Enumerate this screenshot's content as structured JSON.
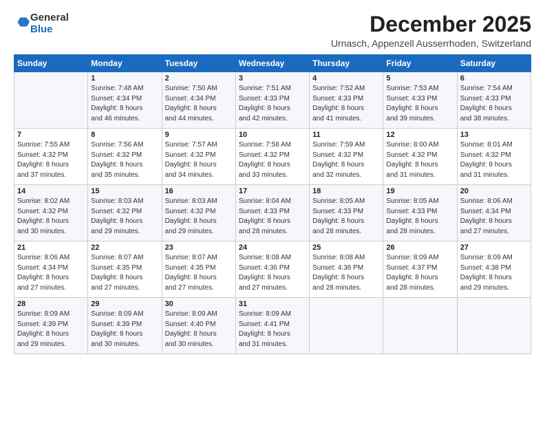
{
  "header": {
    "logo_general": "General",
    "logo_blue": "Blue",
    "month_title": "December 2025",
    "location": "Urnasch, Appenzell Ausserrhoden, Switzerland"
  },
  "columns": [
    "Sunday",
    "Monday",
    "Tuesday",
    "Wednesday",
    "Thursday",
    "Friday",
    "Saturday"
  ],
  "weeks": [
    [
      {
        "day": "",
        "info": ""
      },
      {
        "day": "1",
        "info": "Sunrise: 7:48 AM\nSunset: 4:34 PM\nDaylight: 8 hours\nand 46 minutes."
      },
      {
        "day": "2",
        "info": "Sunrise: 7:50 AM\nSunset: 4:34 PM\nDaylight: 8 hours\nand 44 minutes."
      },
      {
        "day": "3",
        "info": "Sunrise: 7:51 AM\nSunset: 4:33 PM\nDaylight: 8 hours\nand 42 minutes."
      },
      {
        "day": "4",
        "info": "Sunrise: 7:52 AM\nSunset: 4:33 PM\nDaylight: 8 hours\nand 41 minutes."
      },
      {
        "day": "5",
        "info": "Sunrise: 7:53 AM\nSunset: 4:33 PM\nDaylight: 8 hours\nand 39 minutes."
      },
      {
        "day": "6",
        "info": "Sunrise: 7:54 AM\nSunset: 4:33 PM\nDaylight: 8 hours\nand 38 minutes."
      }
    ],
    [
      {
        "day": "7",
        "info": "Sunrise: 7:55 AM\nSunset: 4:32 PM\nDaylight: 8 hours\nand 37 minutes."
      },
      {
        "day": "8",
        "info": "Sunrise: 7:56 AM\nSunset: 4:32 PM\nDaylight: 8 hours\nand 35 minutes."
      },
      {
        "day": "9",
        "info": "Sunrise: 7:57 AM\nSunset: 4:32 PM\nDaylight: 8 hours\nand 34 minutes."
      },
      {
        "day": "10",
        "info": "Sunrise: 7:58 AM\nSunset: 4:32 PM\nDaylight: 8 hours\nand 33 minutes."
      },
      {
        "day": "11",
        "info": "Sunrise: 7:59 AM\nSunset: 4:32 PM\nDaylight: 8 hours\nand 32 minutes."
      },
      {
        "day": "12",
        "info": "Sunrise: 8:00 AM\nSunset: 4:32 PM\nDaylight: 8 hours\nand 31 minutes."
      },
      {
        "day": "13",
        "info": "Sunrise: 8:01 AM\nSunset: 4:32 PM\nDaylight: 8 hours\nand 31 minutes."
      }
    ],
    [
      {
        "day": "14",
        "info": "Sunrise: 8:02 AM\nSunset: 4:32 PM\nDaylight: 8 hours\nand 30 minutes."
      },
      {
        "day": "15",
        "info": "Sunrise: 8:03 AM\nSunset: 4:32 PM\nDaylight: 8 hours\nand 29 minutes."
      },
      {
        "day": "16",
        "info": "Sunrise: 8:03 AM\nSunset: 4:32 PM\nDaylight: 8 hours\nand 29 minutes."
      },
      {
        "day": "17",
        "info": "Sunrise: 8:04 AM\nSunset: 4:33 PM\nDaylight: 8 hours\nand 28 minutes."
      },
      {
        "day": "18",
        "info": "Sunrise: 8:05 AM\nSunset: 4:33 PM\nDaylight: 8 hours\nand 28 minutes."
      },
      {
        "day": "19",
        "info": "Sunrise: 8:05 AM\nSunset: 4:33 PM\nDaylight: 8 hours\nand 28 minutes."
      },
      {
        "day": "20",
        "info": "Sunrise: 8:06 AM\nSunset: 4:34 PM\nDaylight: 8 hours\nand 27 minutes."
      }
    ],
    [
      {
        "day": "21",
        "info": "Sunrise: 8:06 AM\nSunset: 4:34 PM\nDaylight: 8 hours\nand 27 minutes."
      },
      {
        "day": "22",
        "info": "Sunrise: 8:07 AM\nSunset: 4:35 PM\nDaylight: 8 hours\nand 27 minutes."
      },
      {
        "day": "23",
        "info": "Sunrise: 8:07 AM\nSunset: 4:35 PM\nDaylight: 8 hours\nand 27 minutes."
      },
      {
        "day": "24",
        "info": "Sunrise: 8:08 AM\nSunset: 4:36 PM\nDaylight: 8 hours\nand 27 minutes."
      },
      {
        "day": "25",
        "info": "Sunrise: 8:08 AM\nSunset: 4:36 PM\nDaylight: 8 hours\nand 28 minutes."
      },
      {
        "day": "26",
        "info": "Sunrise: 8:09 AM\nSunset: 4:37 PM\nDaylight: 8 hours\nand 28 minutes."
      },
      {
        "day": "27",
        "info": "Sunrise: 8:09 AM\nSunset: 4:38 PM\nDaylight: 8 hours\nand 29 minutes."
      }
    ],
    [
      {
        "day": "28",
        "info": "Sunrise: 8:09 AM\nSunset: 4:39 PM\nDaylight: 8 hours\nand 29 minutes."
      },
      {
        "day": "29",
        "info": "Sunrise: 8:09 AM\nSunset: 4:39 PM\nDaylight: 8 hours\nand 30 minutes."
      },
      {
        "day": "30",
        "info": "Sunrise: 8:09 AM\nSunset: 4:40 PM\nDaylight: 8 hours\nand 30 minutes."
      },
      {
        "day": "31",
        "info": "Sunrise: 8:09 AM\nSunset: 4:41 PM\nDaylight: 8 hours\nand 31 minutes."
      },
      {
        "day": "",
        "info": ""
      },
      {
        "day": "",
        "info": ""
      },
      {
        "day": "",
        "info": ""
      }
    ]
  ]
}
